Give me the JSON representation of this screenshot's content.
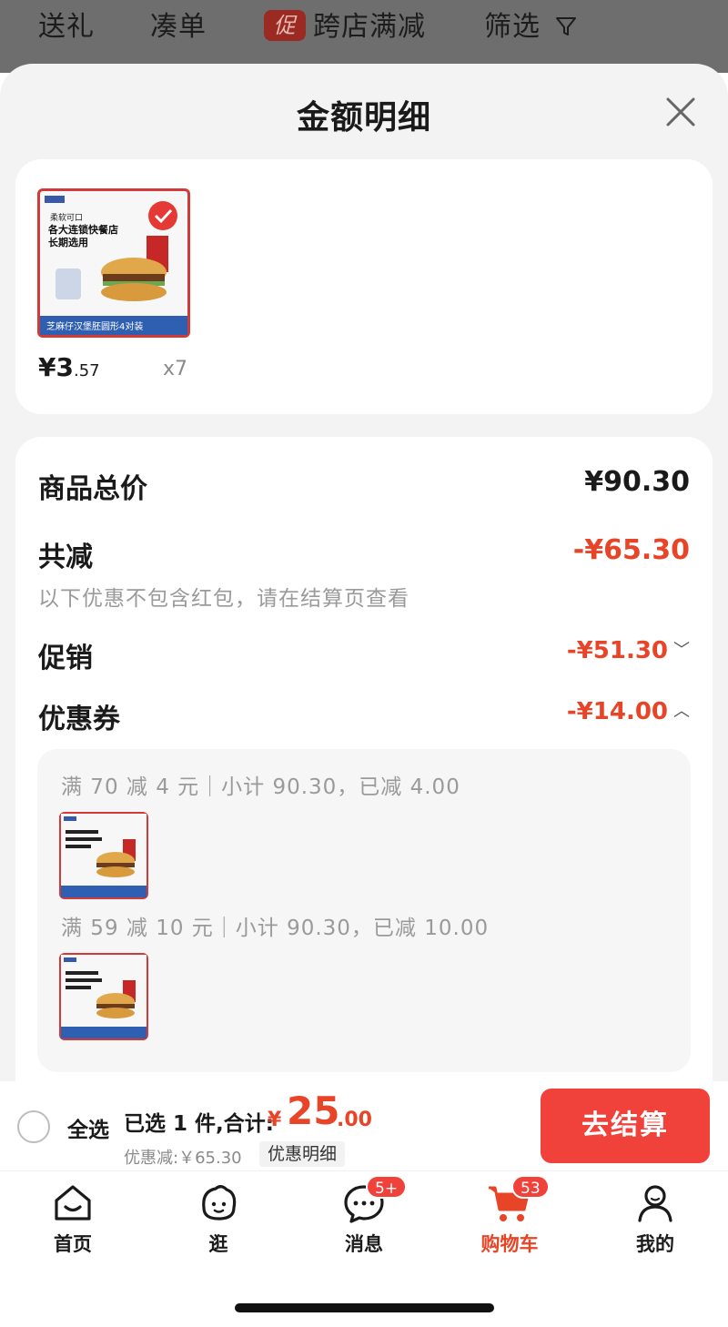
{
  "filter_bar": {
    "items": [
      "送礼",
      "凑单",
      "跨店满减",
      "筛选"
    ],
    "promo_badge": "促"
  },
  "sheet": {
    "title": "金额明细"
  },
  "product": {
    "price_main": "¥3",
    "price_decimal": ".57",
    "quantity": "x7",
    "image_caption": "芝麻仔汉堡胚圆形4对装",
    "image_headline": "各大连锁快餐店",
    "image_subline": "长期选用",
    "image_tag": "柔软可口"
  },
  "detail": {
    "total_label": "商品总价",
    "total_value": "¥90.30",
    "reduce_label": "共减",
    "reduce_value": "-¥65.30",
    "note": "以下优惠不包含红包，请在结算页查看",
    "promo_label": "促销",
    "promo_value": "-¥51.30",
    "coupon_label": "优惠券",
    "coupon_value": "-¥14.00",
    "coupons": [
      {
        "text": "满 70 减 4 元｜小计 90.30，已减 4.00"
      },
      {
        "text": "满 59 减 10 元｜小计 90.30，已减 10.00"
      }
    ]
  },
  "checkout": {
    "select_all": "全选",
    "selected": "已选 1 件,合计:",
    "currency": "¥",
    "total_int": "25",
    "total_dec": ".00",
    "discount": "优惠减:￥65.30",
    "detail_link": "优惠明细",
    "button": "去结算"
  },
  "tabs": [
    {
      "label": "首页"
    },
    {
      "label": "逛"
    },
    {
      "label": "消息",
      "badge": "5+"
    },
    {
      "label": "购物车",
      "badge": "53"
    },
    {
      "label": "我的"
    }
  ],
  "colors": {
    "accent": "#e84427",
    "button": "#f0423a"
  }
}
